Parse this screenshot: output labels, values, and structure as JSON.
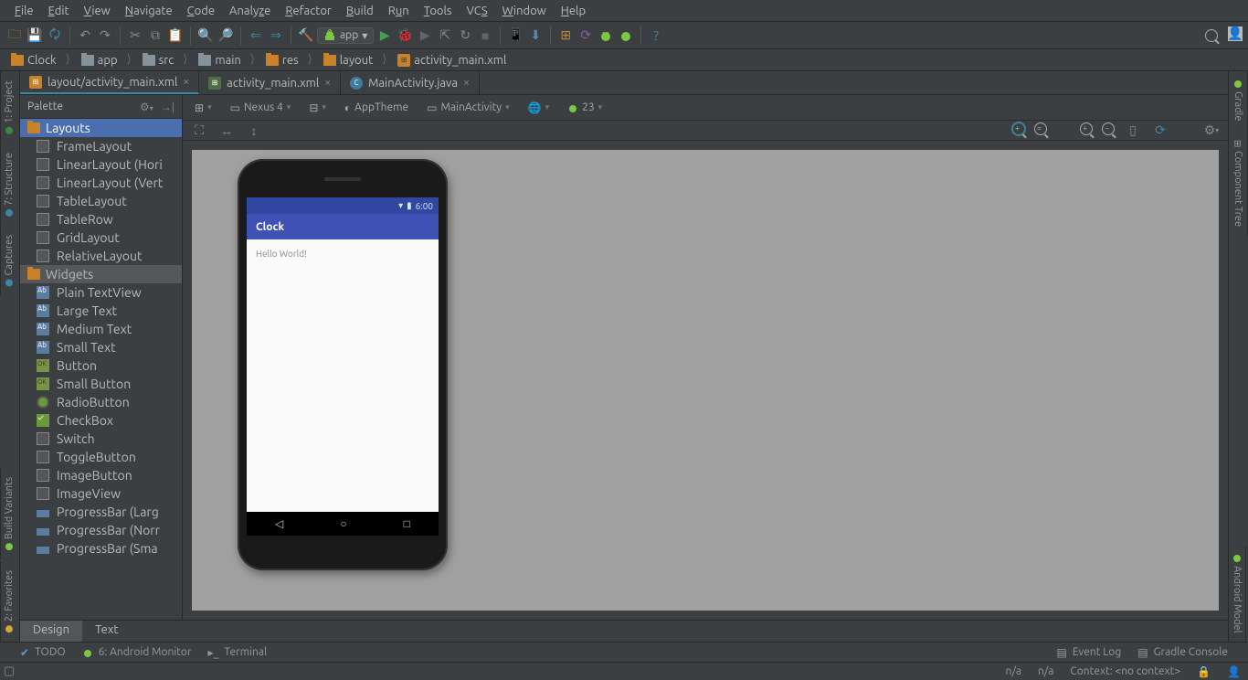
{
  "menu": [
    "File",
    "Edit",
    "View",
    "Navigate",
    "Code",
    "Analyze",
    "Refactor",
    "Build",
    "Run",
    "Tools",
    "VCS",
    "Window",
    "Help"
  ],
  "runConfig": "app",
  "breadcrumb": [
    "Clock",
    "app",
    "src",
    "main",
    "res",
    "layout",
    "activity_main.xml"
  ],
  "tabs": [
    {
      "label": "layout/activity_main.xml",
      "type": "layout",
      "active": true
    },
    {
      "label": "activity_main.xml",
      "type": "xml",
      "active": false
    },
    {
      "label": "MainActivity.java",
      "type": "java",
      "active": false
    }
  ],
  "palette": {
    "title": "Palette",
    "groups": [
      {
        "name": "Layouts",
        "selected": true,
        "items": [
          "FrameLayout",
          "LinearLayout (Hori",
          "LinearLayout (Vert",
          "TableLayout",
          "TableRow",
          "GridLayout",
          "RelativeLayout"
        ]
      },
      {
        "name": "Widgets",
        "selected": false,
        "items": [
          "Plain TextView",
          "Large Text",
          "Medium Text",
          "Small Text",
          "Button",
          "Small Button",
          "RadioButton",
          "CheckBox",
          "Switch",
          "ToggleButton",
          "ImageButton",
          "ImageView",
          "ProgressBar (Larg",
          "ProgressBar (Norr",
          "ProgressBar (Sma"
        ]
      }
    ]
  },
  "designToolbar": {
    "device": "Nexus 4",
    "theme": "AppTheme",
    "activity": "MainActivity",
    "api": "23"
  },
  "preview": {
    "statusTime": "6:00",
    "appTitle": "Clock",
    "content": "Hello World!"
  },
  "designerTabs": [
    "Design",
    "Text"
  ],
  "leftRail": [
    {
      "label": "1: Project",
      "color": "#3a8a3a"
    },
    {
      "label": "7: Structure",
      "color": "#3e86a0"
    },
    {
      "label": "Captures",
      "color": "#3e86a0"
    },
    {
      "label": "Build Variants",
      "color": "#7cc843"
    },
    {
      "label": "2: Favorites",
      "color": "#d8a33b"
    }
  ],
  "rightRail": [
    {
      "label": "Gradle",
      "color": "#7cc843"
    },
    {
      "label": "Component Tree",
      "color": ""
    },
    {
      "label": "Android Model",
      "color": "#7cc843"
    }
  ],
  "bottomTools": {
    "left": [
      "TODO",
      "6: Android Monitor",
      "Terminal"
    ],
    "right": [
      "Event Log",
      "Gradle Console"
    ]
  },
  "status": {
    "col1": "n/a",
    "col2": "n/a",
    "context": "Context: <no context>"
  }
}
